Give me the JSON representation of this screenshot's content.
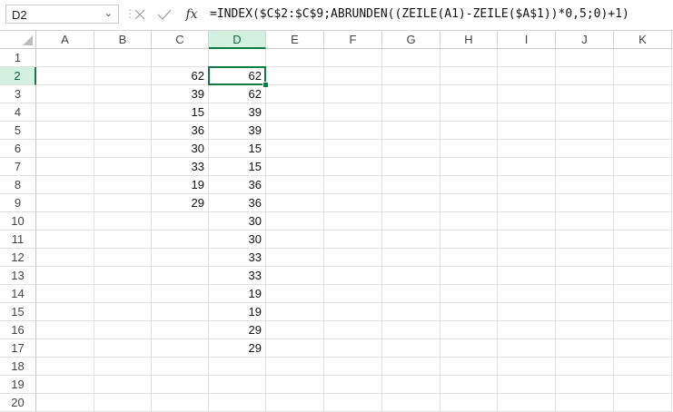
{
  "name_box": {
    "value": "D2",
    "dropdown_icon": "chevron-down-icon"
  },
  "formula_bar": {
    "separator": "⋮",
    "cancel_icon": "close-icon",
    "enter_icon": "check-icon",
    "fx_label": "fx",
    "formula": "=INDEX($C$2:$C$9;ABRUNDEN((ZEILE(A1)-ZEILE($A$1))*0,5;0)+1)"
  },
  "colors": {
    "accent": "#107c41",
    "header_selected_bg": "#d3f0e0",
    "gridline": "#e1e1e1"
  },
  "columns": [
    "A",
    "B",
    "C",
    "D",
    "E",
    "F",
    "G",
    "H",
    "I",
    "J",
    "K"
  ],
  "selected_column": "D",
  "selected_row": "2",
  "rows": [
    {
      "n": "1",
      "C": "",
      "D": ""
    },
    {
      "n": "2",
      "C": "62",
      "D": "62"
    },
    {
      "n": "3",
      "C": "39",
      "D": "62"
    },
    {
      "n": "4",
      "C": "15",
      "D": "39"
    },
    {
      "n": "5",
      "C": "36",
      "D": "39"
    },
    {
      "n": "6",
      "C": "30",
      "D": "15"
    },
    {
      "n": "7",
      "C": "33",
      "D": "15"
    },
    {
      "n": "8",
      "C": "19",
      "D": "36"
    },
    {
      "n": "9",
      "C": "29",
      "D": "36"
    },
    {
      "n": "10",
      "C": "",
      "D": "30"
    },
    {
      "n": "11",
      "C": "",
      "D": "30"
    },
    {
      "n": "12",
      "C": "",
      "D": "33"
    },
    {
      "n": "13",
      "C": "",
      "D": "33"
    },
    {
      "n": "14",
      "C": "",
      "D": "19"
    },
    {
      "n": "15",
      "C": "",
      "D": "19"
    },
    {
      "n": "16",
      "C": "",
      "D": "29"
    },
    {
      "n": "17",
      "C": "",
      "D": "29"
    },
    {
      "n": "18",
      "C": "",
      "D": ""
    },
    {
      "n": "19",
      "C": "",
      "D": ""
    },
    {
      "n": "20",
      "C": "",
      "D": ""
    }
  ]
}
